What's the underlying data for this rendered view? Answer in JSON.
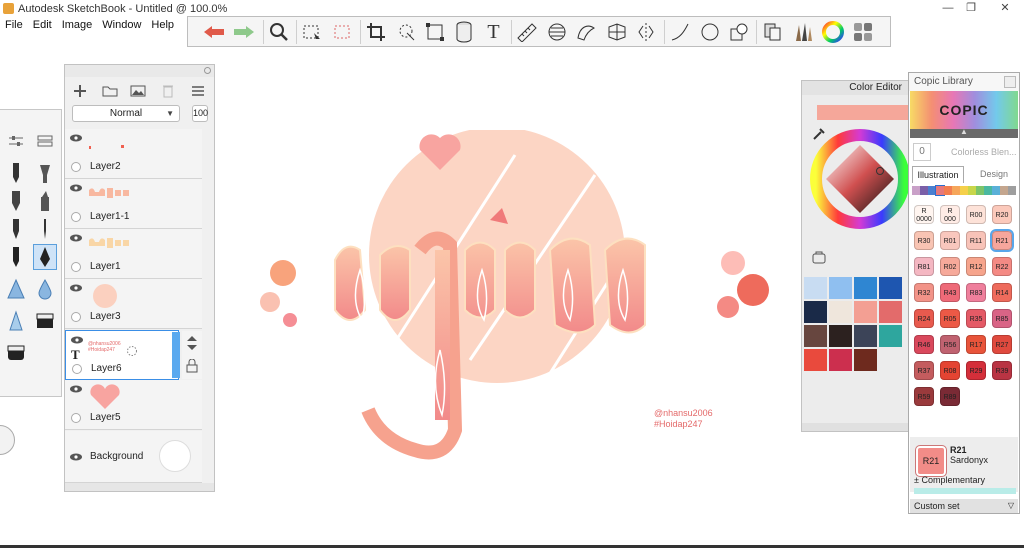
{
  "window": {
    "title": "Autodesk SketchBook - Untitled @ 100.0%",
    "min": "—",
    "max": "❐",
    "close": "✕"
  },
  "menu": [
    "File",
    "Edit",
    "Image",
    "Window",
    "Help"
  ],
  "toolbar": {
    "icons": [
      "undo-icon",
      "redo-icon",
      "magnifier-icon",
      "select-rect-icon",
      "select-dashed-icon",
      "crop-icon",
      "lasso-icon",
      "transform-icon",
      "cylinder-icon",
      "text-tool-icon",
      "ruler-icon",
      "ellipse-guide-icon",
      "french-curve-icon",
      "perspective-icon",
      "symmetry-icon",
      "stroke-icon",
      "circle-icon",
      "shape-icon",
      "copy-paste-icon",
      "brushes-icon",
      "color-wheel-icon",
      "puck-icon"
    ],
    "text_glyph": "T",
    "colors": {
      "undo": "#e05a4a",
      "redo": "#8ec98b"
    }
  },
  "layers": {
    "blend_mode": "Normal",
    "opacity": "100",
    "items": [
      {
        "name": "Layer2"
      },
      {
        "name": "Layer1-1"
      },
      {
        "name": "Layer1"
      },
      {
        "name": "Layer3"
      },
      {
        "name": "Layer6",
        "selected": true,
        "text_thumb_1": "@nhansu2006",
        "text_thumb_2": "#Hoidap247"
      },
      {
        "name": "Layer5"
      },
      {
        "name": "Background"
      }
    ]
  },
  "canvas": {
    "watermark_line1": "@nhansu2006",
    "watermark_line2": "#Hoidap247",
    "colors": {
      "circle": "#fcd5c4",
      "letters": "#f7a897",
      "heart": "#f8a4a0"
    }
  },
  "color_editor": {
    "title": "Color Editor",
    "current": "#f5a79a",
    "swatches": [
      "#c8dcf2",
      "#8fbff0",
      "#2f86d2",
      "#1e56b0",
      "#1a2a48",
      "#efe6dc",
      "#f39f93",
      "#e36b6b",
      "#67463f",
      "#2c211f",
      "#3c4458",
      "#2ea69e",
      "#e94a3d",
      "#cc2f4e",
      "#6e2a1e"
    ]
  },
  "copic": {
    "title": "Copic Library",
    "logo": "COPIC",
    "collapse": "▲",
    "colorless_button": "0",
    "colorless_label": "Colorless Blen...",
    "tabs": [
      "Illustration",
      "Design"
    ],
    "hue_colors": [
      "#c9a0c8",
      "#7a5fa8",
      "#4a7fd0",
      "#e6787a",
      "#f27d4f",
      "#f6a65a",
      "#f5d04a",
      "#c8d64a",
      "#7cc46a",
      "#4ab8a0",
      "#5ab0d8",
      "#c4a68e",
      "#9e9e9e"
    ],
    "chips": [
      {
        "code": "R\n0000",
        "color": "#fff5f0"
      },
      {
        "code": "R\n000",
        "color": "#ffece6"
      },
      {
        "code": "R00",
        "color": "#fde2d8"
      },
      {
        "code": "R20",
        "color": "#fbc9bb"
      },
      {
        "code": "R30",
        "color": "#f8c4b3"
      },
      {
        "code": "R01",
        "color": "#f9c7bd"
      },
      {
        "code": "R11",
        "color": "#f8c3b8"
      },
      {
        "code": "R21",
        "color": "#f7a69c",
        "selected": true
      },
      {
        "code": "R81",
        "color": "#f4b7c2"
      },
      {
        "code": "R02",
        "color": "#f6a99a"
      },
      {
        "code": "R12",
        "color": "#f6a48c"
      },
      {
        "code": "R22",
        "color": "#f48a84"
      },
      {
        "code": "R32",
        "color": "#f29388"
      },
      {
        "code": "R43",
        "color": "#ee6a78"
      },
      {
        "code": "R83",
        "color": "#ef7f9c"
      },
      {
        "code": "R14",
        "color": "#ee6b5c"
      },
      {
        "code": "R24",
        "color": "#e85a4e"
      },
      {
        "code": "R05",
        "color": "#ec5946"
      },
      {
        "code": "R35",
        "color": "#e45a66"
      },
      {
        "code": "R85",
        "color": "#d96486"
      },
      {
        "code": "R46",
        "color": "#d9485c"
      },
      {
        "code": "R56",
        "color": "#c06270"
      },
      {
        "code": "R17",
        "color": "#e8543a"
      },
      {
        "code": "R27",
        "color": "#e04a3e"
      },
      {
        "code": "R37",
        "color": "#c45c5e"
      },
      {
        "code": "R08",
        "color": "#e44432"
      },
      {
        "code": "R29",
        "color": "#d42f3a"
      },
      {
        "code": "R39",
        "color": "#b93443"
      },
      {
        "code": "R59",
        "color": "#9a3a3c"
      },
      {
        "code": "R89",
        "color": "#7a2a35"
      }
    ],
    "selected_code": "R21",
    "selected_name": "Sardonyx",
    "complementary": "± Complementary",
    "custom_set": "Custom set"
  }
}
